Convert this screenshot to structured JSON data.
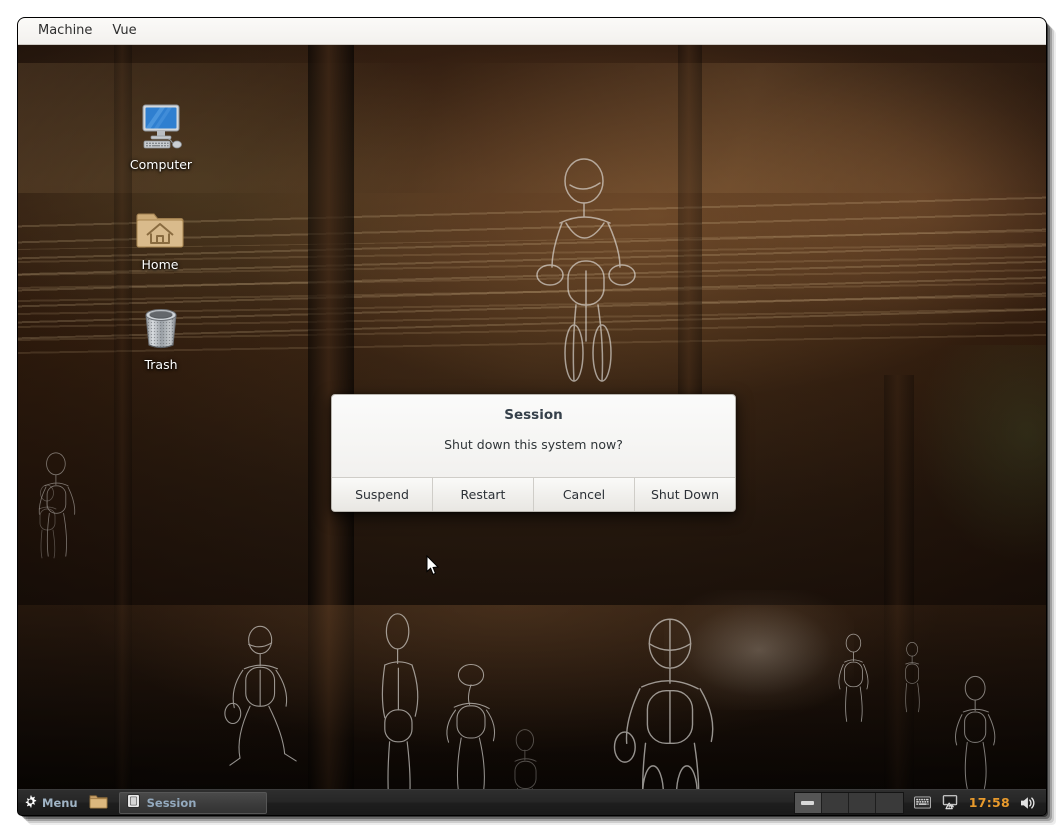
{
  "vm_window": {
    "menubar": {
      "items": [
        {
          "label": "Machine",
          "name": "vm-menu-machine"
        },
        {
          "label": "Vue",
          "name": "vm-menu-vue"
        }
      ]
    }
  },
  "desktop": {
    "icons": [
      {
        "label": "Computer",
        "icon": "computer-monitor-icon"
      },
      {
        "label": "Home",
        "icon": "home-folder-icon"
      },
      {
        "label": "Trash",
        "icon": "trash-can-icon"
      }
    ],
    "wallpaper_description": "Dark warm-toned interior photograph overlaid with white wireframe human figures"
  },
  "dialog": {
    "title": "Session",
    "message": "Shut down this system now?",
    "buttons": [
      {
        "label": "Suspend"
      },
      {
        "label": "Restart"
      },
      {
        "label": "Cancel"
      },
      {
        "label": "Shut Down"
      }
    ]
  },
  "panel": {
    "menu_button": {
      "label": "Menu",
      "icon": "gear-icon"
    },
    "launchers": [
      {
        "icon": "folder-icon"
      }
    ],
    "tasks": [
      {
        "label": "Session",
        "icon": "window-icon",
        "active": true
      }
    ],
    "workspaces": [
      {
        "active": true
      },
      {
        "active": false
      },
      {
        "active": false
      },
      {
        "active": false
      }
    ],
    "tray": [
      {
        "icon": "keyboard-icon"
      },
      {
        "icon": "network-warning-icon"
      }
    ],
    "clock": "17:58",
    "volume": {
      "icon": "speaker-icon"
    }
  },
  "colors": {
    "panel_background": "#262626",
    "panel_text": "#9fb3c4",
    "clock_text": "#e89a2c",
    "dialog_title": "#35404a",
    "dialog_background": "#f3f2f0",
    "desktop_icon_label": "#ffffff"
  }
}
